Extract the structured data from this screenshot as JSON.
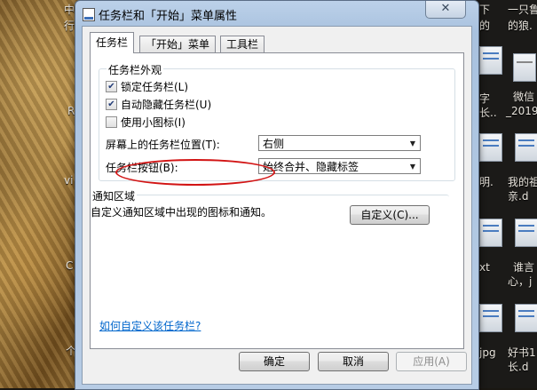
{
  "desktop": {
    "top_left_a": "中",
    "top_left_b": "行",
    "left_r": "R",
    "left_v": "vi",
    "left_c": "C",
    "left_m": "个",
    "right_col1": [
      "下",
      "的",
      "字",
      "长..",
      "明.",
      "xt",
      "jpg"
    ],
    "right_col2": [
      "一只鲁",
      "的狼.",
      "微信",
      "_2019",
      "我的祖",
      "亲.d",
      "谁言",
      "心，j",
      "好书1",
      "长.d"
    ]
  },
  "dialog": {
    "title": "任务栏和「开始」菜单属性",
    "close_glyph": "✕",
    "tabs": [
      "任务栏",
      "「开始」菜单",
      "工具栏"
    ],
    "appearance": {
      "label": "任务栏外观",
      "lock": {
        "label": "锁定任务栏(L)",
        "checked": true
      },
      "autohide": {
        "label": "自动隐藏任务栏(U)",
        "checked": true
      },
      "small_icons": {
        "label": "使用小图标(I)",
        "checked": false
      },
      "position_label": "屏幕上的任务栏位置(T):",
      "position_value": "右侧",
      "buttons_label": "任务栏按钮(B):",
      "buttons_value": "始终合并、隐藏标签"
    },
    "notification": {
      "label": "通知区域",
      "description": "自定义通知区域中出现的图标和通知。",
      "customize_button": "自定义(C)..."
    },
    "help_link": "如何自定义该任务栏?",
    "ok_button": "确定",
    "cancel_button": "取消",
    "apply_button": "应用(A)",
    "checkmark": "✔",
    "dropdown_arrow": "▼"
  },
  "colors": {
    "annotation_ellipse": "#d21414",
    "link": "#0066cc"
  }
}
